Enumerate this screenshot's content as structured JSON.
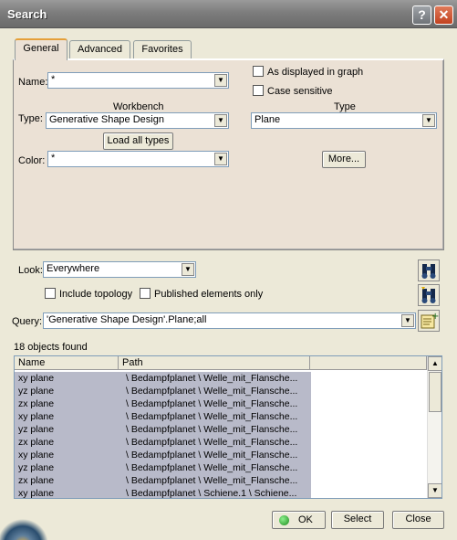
{
  "window": {
    "title": "Search"
  },
  "tabs": [
    "General",
    "Advanced",
    "Favorites"
  ],
  "general": {
    "name_label": "Name:",
    "name_value": "*",
    "as_displayed_label": "As displayed in graph",
    "case_sensitive_label": "Case sensitive",
    "workbench_header": "Workbench",
    "type_label": "Type:",
    "workbench_value": "Generative Shape Design",
    "type_header": "Type",
    "type_value": "Plane",
    "load_all_types": "Load all types",
    "color_label": "Color:",
    "color_value": "*",
    "more_button": "More..."
  },
  "look": {
    "label": "Look:",
    "value": "Everywhere",
    "include_topology": "Include topology",
    "published_only": "Published elements only"
  },
  "query": {
    "label": "Query:",
    "value": "'Generative Shape Design'.Plane;all"
  },
  "results": {
    "count_text": "18 objects found",
    "columns": [
      "Name",
      "Path"
    ],
    "rows": [
      {
        "name": "xy plane",
        "path": "\\ Bedampfplanet \\ Welle_mit_Flansche..."
      },
      {
        "name": "yz plane",
        "path": "\\ Bedampfplanet \\ Welle_mit_Flansche..."
      },
      {
        "name": "zx plane",
        "path": "\\ Bedampfplanet \\ Welle_mit_Flansche..."
      },
      {
        "name": "xy plane",
        "path": "\\ Bedampfplanet \\ Welle_mit_Flansche..."
      },
      {
        "name": "yz plane",
        "path": "\\ Bedampfplanet \\ Welle_mit_Flansche..."
      },
      {
        "name": "zx plane",
        "path": "\\ Bedampfplanet \\ Welle_mit_Flansche..."
      },
      {
        "name": "xy plane",
        "path": "\\ Bedampfplanet \\ Welle_mit_Flansche..."
      },
      {
        "name": "yz plane",
        "path": "\\ Bedampfplanet \\ Welle_mit_Flansche..."
      },
      {
        "name": "zx plane",
        "path": "\\ Bedampfplanet \\ Welle_mit_Flansche..."
      },
      {
        "name": "xy plane",
        "path": "\\ Bedampfplanet \\ Schiene.1 \\ Schiene..."
      }
    ]
  },
  "buttons": {
    "ok": "OK",
    "select": "Select",
    "close": "Close"
  },
  "titlebar_buttons": {
    "help": "?",
    "close": "✕"
  }
}
